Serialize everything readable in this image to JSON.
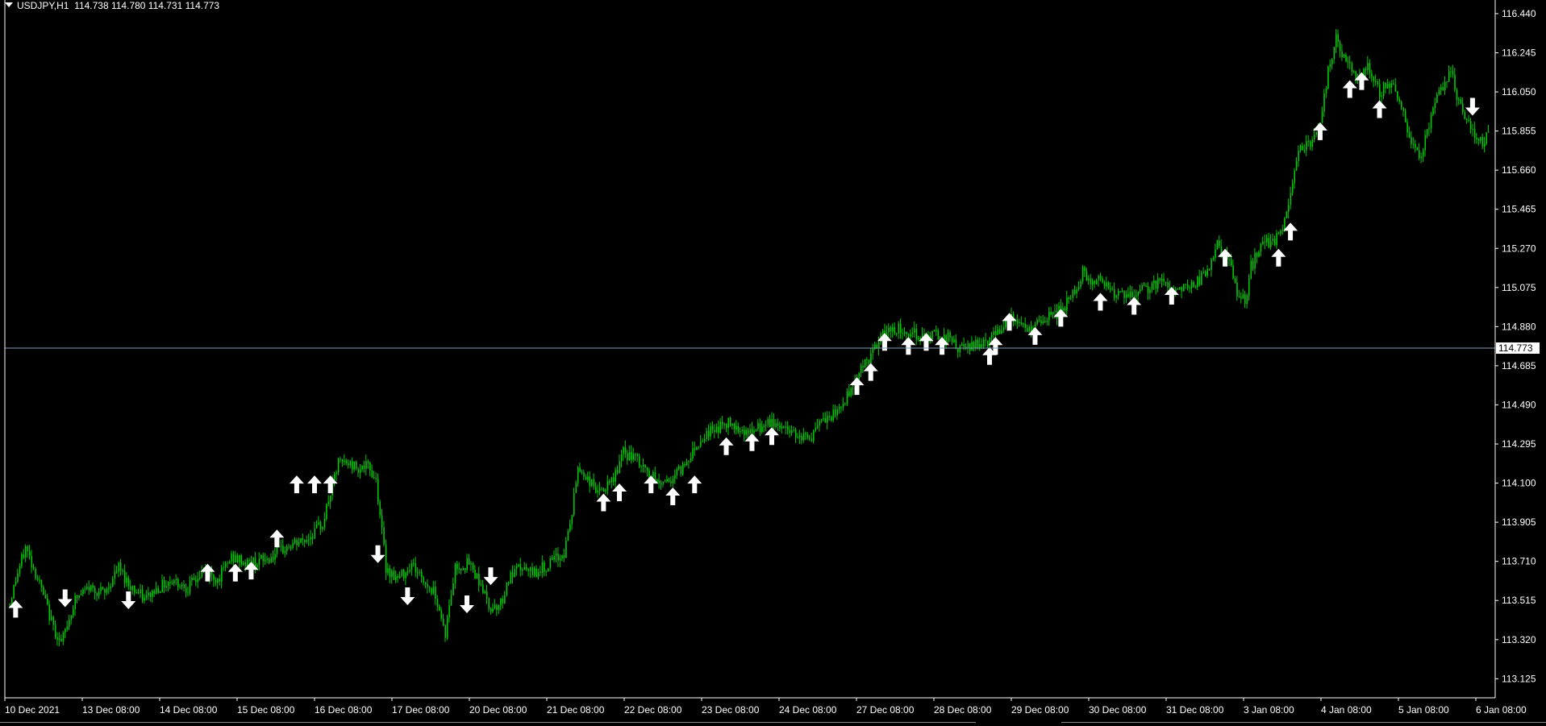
{
  "header": {
    "symbol_timeframe": "USDJPY,H1",
    "ohlc": "114.738 114.780 114.731 114.773"
  },
  "colors": {
    "background": "#000000",
    "candles": "#00cc00",
    "grid_axis": "#ffffff",
    "price_line": "#7f9cb5",
    "arrows": "#ffffff"
  },
  "chart_data": {
    "type": "candlestick",
    "symbol": "USDJPY",
    "timeframe": "H1",
    "current_price": "114.773",
    "ylim": [
      113.03,
      116.5
    ],
    "y_ticks": [
      "116.440",
      "116.245",
      "116.050",
      "115.855",
      "115.660",
      "115.465",
      "115.270",
      "115.075",
      "114.880",
      "114.685",
      "114.490",
      "114.295",
      "114.100",
      "113.905",
      "113.710",
      "113.515",
      "113.320",
      "113.125"
    ],
    "x_ticks": [
      "10 Dec 2021",
      "13 Dec 08:00",
      "14 Dec 08:00",
      "15 Dec 08:00",
      "16 Dec 08:00",
      "17 Dec 08:00",
      "20 Dec 08:00",
      "21 Dec 08:00",
      "22 Dec 08:00",
      "23 Dec 08:00",
      "24 Dec 08:00",
      "27 Dec 08:00",
      "28 Dec 08:00",
      "29 Dec 08:00",
      "30 Dec 08:00",
      "31 Dec 08:00",
      "3 Jan 08:00",
      "4 Jan 08:00",
      "5 Jan 08:00",
      "6 Jan 08:00"
    ],
    "price_path": [
      [
        0,
        113.5
      ],
      [
        3,
        113.62
      ],
      [
        8,
        113.78
      ],
      [
        15,
        113.6
      ],
      [
        22,
        113.38
      ],
      [
        26,
        113.3
      ],
      [
        33,
        113.52
      ],
      [
        40,
        113.58
      ],
      [
        48,
        113.55
      ],
      [
        55,
        113.68
      ],
      [
        60,
        113.6
      ],
      [
        68,
        113.52
      ],
      [
        75,
        113.58
      ],
      [
        82,
        113.62
      ],
      [
        90,
        113.58
      ],
      [
        98,
        113.66
      ],
      [
        105,
        113.62
      ],
      [
        112,
        113.73
      ],
      [
        120,
        113.7
      ],
      [
        130,
        113.72
      ],
      [
        140,
        113.78
      ],
      [
        150,
        113.82
      ],
      [
        158,
        113.9
      ],
      [
        162,
        114.05
      ],
      [
        166,
        114.2
      ],
      [
        170,
        114.2
      ],
      [
        176,
        114.18
      ],
      [
        181,
        114.18
      ],
      [
        185,
        114.12
      ],
      [
        187,
        113.95
      ],
      [
        190,
        113.68
      ],
      [
        196,
        113.62
      ],
      [
        203,
        113.7
      ],
      [
        210,
        113.6
      ],
      [
        215,
        113.55
      ],
      [
        220,
        113.35
      ],
      [
        225,
        113.68
      ],
      [
        232,
        113.7
      ],
      [
        238,
        113.6
      ],
      [
        242,
        113.48
      ],
      [
        248,
        113.5
      ],
      [
        252,
        113.62
      ],
      [
        258,
        113.68
      ],
      [
        263,
        113.65
      ],
      [
        270,
        113.68
      ],
      [
        276,
        113.72
      ],
      [
        280,
        113.75
      ],
      [
        284,
        113.95
      ],
      [
        287,
        114.18
      ],
      [
        292,
        114.12
      ],
      [
        298,
        114.05
      ],
      [
        304,
        114.1
      ],
      [
        310,
        114.25
      ],
      [
        316,
        114.22
      ],
      [
        322,
        114.15
      ],
      [
        328,
        114.1
      ],
      [
        334,
        114.12
      ],
      [
        340,
        114.18
      ],
      [
        346,
        114.28
      ],
      [
        352,
        114.35
      ],
      [
        358,
        114.38
      ],
      [
        364,
        114.4
      ],
      [
        368,
        114.38
      ],
      [
        374,
        114.35
      ],
      [
        380,
        114.38
      ],
      [
        386,
        114.4
      ],
      [
        392,
        114.37
      ],
      [
        398,
        114.35
      ],
      [
        404,
        114.32
      ],
      [
        410,
        114.4
      ],
      [
        418,
        114.45
      ],
      [
        424,
        114.55
      ],
      [
        430,
        114.68
      ],
      [
        434,
        114.72
      ],
      [
        438,
        114.78
      ],
      [
        442,
        114.85
      ],
      [
        448,
        114.87
      ],
      [
        455,
        114.85
      ],
      [
        462,
        114.83
      ],
      [
        470,
        114.84
      ],
      [
        475,
        114.82
      ],
      [
        480,
        114.76
      ],
      [
        485,
        114.78
      ],
      [
        490,
        114.8
      ],
      [
        496,
        114.82
      ],
      [
        502,
        114.9
      ],
      [
        508,
        114.92
      ],
      [
        514,
        114.85
      ],
      [
        520,
        114.9
      ],
      [
        526,
        114.93
      ],
      [
        532,
        114.97
      ],
      [
        538,
        115.05
      ],
      [
        542,
        115.15
      ],
      [
        547,
        115.1
      ],
      [
        552,
        115.12
      ],
      [
        558,
        115.05
      ],
      [
        564,
        115.02
      ],
      [
        570,
        115.05
      ],
      [
        576,
        115.08
      ],
      [
        582,
        115.1
      ],
      [
        588,
        115.06
      ],
      [
        594,
        115.08
      ],
      [
        600,
        115.1
      ],
      [
        606,
        115.18
      ],
      [
        610,
        115.28
      ],
      [
        616,
        115.2
      ],
      [
        620,
        115.05
      ],
      [
        624,
        115.0
      ],
      [
        627,
        115.18
      ],
      [
        633,
        115.3
      ],
      [
        638,
        115.3
      ],
      [
        643,
        115.35
      ],
      [
        647,
        115.55
      ],
      [
        652,
        115.78
      ],
      [
        658,
        115.8
      ],
      [
        662,
        115.9
      ],
      [
        666,
        116.15
      ],
      [
        670,
        116.32
      ],
      [
        674,
        116.22
      ],
      [
        680,
        116.12
      ],
      [
        686,
        116.18
      ],
      [
        692,
        116.05
      ],
      [
        698,
        116.1
      ],
      [
        704,
        115.95
      ],
      [
        708,
        115.8
      ],
      [
        712,
        115.72
      ],
      [
        716,
        115.85
      ],
      [
        722,
        116.05
      ],
      [
        728,
        116.15
      ],
      [
        732,
        116.0
      ],
      [
        736,
        115.92
      ],
      [
        740,
        115.85
      ],
      [
        744,
        115.78
      ],
      [
        748,
        115.9
      ]
    ],
    "bars": 748,
    "arrows": [
      {
        "bar": 3,
        "price": 113.47,
        "dir": "up"
      },
      {
        "bar": 28,
        "price": 113.53,
        "dir": "down"
      },
      {
        "bar": 60,
        "price": 113.52,
        "dir": "down"
      },
      {
        "bar": 100,
        "price": 113.65,
        "dir": "up"
      },
      {
        "bar": 114,
        "price": 113.65,
        "dir": "up"
      },
      {
        "bar": 122,
        "price": 113.66,
        "dir": "up"
      },
      {
        "bar": 135,
        "price": 113.82,
        "dir": "up"
      },
      {
        "bar": 145,
        "price": 114.09,
        "dir": "up"
      },
      {
        "bar": 154,
        "price": 114.09,
        "dir": "up"
      },
      {
        "bar": 162,
        "price": 114.09,
        "dir": "up"
      },
      {
        "bar": 186,
        "price": 113.75,
        "dir": "down"
      },
      {
        "bar": 201,
        "price": 113.54,
        "dir": "down"
      },
      {
        "bar": 231,
        "price": 113.5,
        "dir": "down"
      },
      {
        "bar": 243,
        "price": 113.64,
        "dir": "down"
      },
      {
        "bar": 300,
        "price": 114.0,
        "dir": "up"
      },
      {
        "bar": 308,
        "price": 114.05,
        "dir": "up"
      },
      {
        "bar": 324,
        "price": 114.09,
        "dir": "up"
      },
      {
        "bar": 335,
        "price": 114.03,
        "dir": "up"
      },
      {
        "bar": 346,
        "price": 114.09,
        "dir": "up"
      },
      {
        "bar": 362,
        "price": 114.28,
        "dir": "up"
      },
      {
        "bar": 375,
        "price": 114.3,
        "dir": "up"
      },
      {
        "bar": 385,
        "price": 114.33,
        "dir": "up"
      },
      {
        "bar": 428,
        "price": 114.58,
        "dir": "up"
      },
      {
        "bar": 435,
        "price": 114.65,
        "dir": "up"
      },
      {
        "bar": 442,
        "price": 114.8,
        "dir": "up"
      },
      {
        "bar": 454,
        "price": 114.78,
        "dir": "up"
      },
      {
        "bar": 463,
        "price": 114.8,
        "dir": "up"
      },
      {
        "bar": 471,
        "price": 114.78,
        "dir": "up"
      },
      {
        "bar": 495,
        "price": 114.73,
        "dir": "up"
      },
      {
        "bar": 498,
        "price": 114.78,
        "dir": "up"
      },
      {
        "bar": 505,
        "price": 114.9,
        "dir": "up"
      },
      {
        "bar": 518,
        "price": 114.83,
        "dir": "up"
      },
      {
        "bar": 531,
        "price": 114.92,
        "dir": "up"
      },
      {
        "bar": 551,
        "price": 115.0,
        "dir": "up"
      },
      {
        "bar": 568,
        "price": 114.98,
        "dir": "up"
      },
      {
        "bar": 587,
        "price": 115.03,
        "dir": "up"
      },
      {
        "bar": 614,
        "price": 115.22,
        "dir": "up"
      },
      {
        "bar": 641,
        "price": 115.22,
        "dir": "up"
      },
      {
        "bar": 647,
        "price": 115.35,
        "dir": "up"
      },
      {
        "bar": 662,
        "price": 115.85,
        "dir": "up"
      },
      {
        "bar": 677,
        "price": 116.06,
        "dir": "up"
      },
      {
        "bar": 683,
        "price": 116.1,
        "dir": "up"
      },
      {
        "bar": 692,
        "price": 115.96,
        "dir": "up"
      },
      {
        "bar": 739,
        "price": 115.98,
        "dir": "down"
      }
    ]
  }
}
